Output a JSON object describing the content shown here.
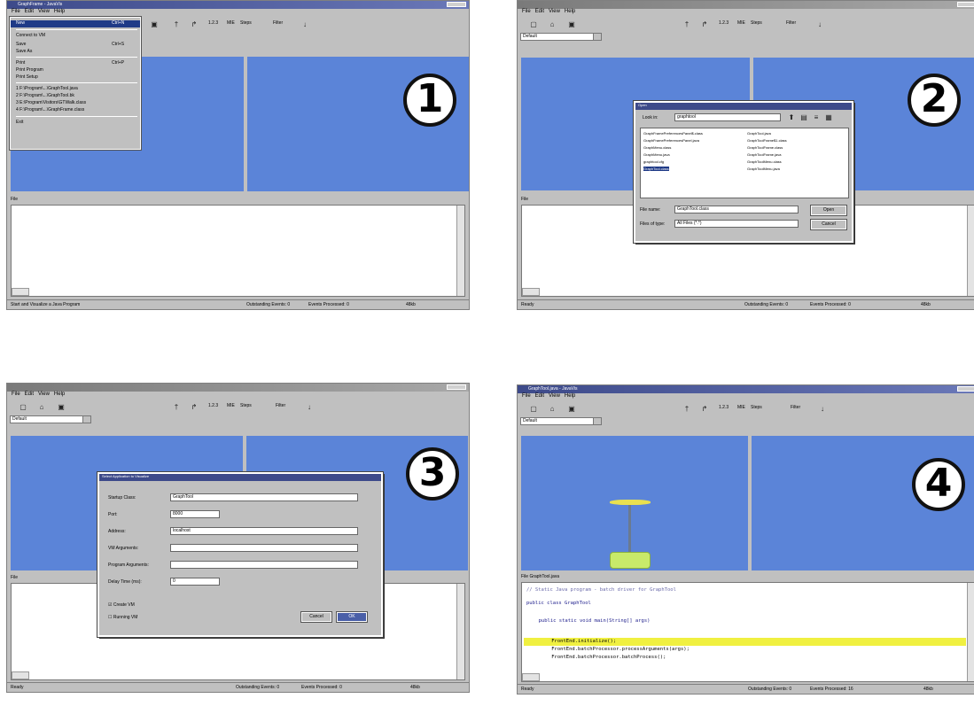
{
  "tool": {
    "debug": "MIE",
    "steps": "Steps",
    "filter": "Filter"
  },
  "combo": "Default",
  "file_label": "File",
  "status": {
    "default_left": "Ready",
    "step1_left": "Start and Visualize a Java Program",
    "outstanding": "Outstanding Events: 0",
    "processed": "Events Processed: 0",
    "step4_processed": "Events Processed: 16",
    "mem": "48kb"
  },
  "badges": [
    "1",
    "2",
    "3",
    "4"
  ],
  "menubar": {
    "file": "File",
    "edit": "Edit",
    "view": "View",
    "help": "Help"
  },
  "w1": {
    "title": "GraphFrame - JavaVis",
    "menu": {
      "new": "New",
      "new_acc": "Ctrl+N",
      "connect": "Connect to VM",
      "save": "Save",
      "save_acc": "Ctrl+S",
      "save_as": "Save As",
      "print": "Print",
      "print_acc": "Ctrl+P",
      "print_program": "Print Program",
      "print_setup": "Print Setup",
      "recent": [
        "1 F:\\Program\\...\\GraphTool.java",
        "2 F:\\Program\\...\\GraphTool.bk",
        "3 E:\\Program\\Visitors\\GTWalk.class",
        "4 F:\\Program\\...\\GraphFrame.class"
      ],
      "exit": "Exit"
    }
  },
  "w2": {
    "dialog": {
      "title": "Open",
      "look_in_label": "Look in:",
      "look_in": "graphtool",
      "files_col1": [
        "GraphFramePreferencesPanel$.class",
        "GraphFramePreferencesPanel.java",
        "GraphMenu.class",
        "GraphMenu.java",
        "graphtool.cfg",
        "GraphTool.class"
      ],
      "files_col2": [
        "GraphTool.java",
        "GraphToolFrame$1.class",
        "GraphToolFrame.class",
        "GraphToolFrame.java",
        "GraphToolMenu.class",
        "GraphToolMenu.java"
      ],
      "filename_label": "File name:",
      "filename": "GraphTool.class",
      "filetype_label": "Files of type:",
      "filetype": "All Files (*.*)",
      "open": "Open",
      "cancel": "Cancel"
    }
  },
  "w3": {
    "dialog": {
      "title": "Select Application to Visualize",
      "fields": [
        {
          "label": "Startup Class:",
          "value": "GraphTool"
        },
        {
          "label": "Port:",
          "value": "8000"
        },
        {
          "label": "Address:",
          "value": "localhost"
        },
        {
          "label": "VM Arguments:",
          "value": ""
        },
        {
          "label": "Program Arguments:",
          "value": ""
        },
        {
          "label": "Delay Time (ms):",
          "value": "0"
        }
      ],
      "check_launch": "Create VM",
      "check_running": "Running VM",
      "cancel": "Cancel",
      "ok": "OK"
    }
  },
  "w4": {
    "title": "GraphTool.java - JavaVis",
    "tabs": "File  GraphTool.java",
    "code": [
      "// Static Java program - batch driver for GraphTool",
      "public class GraphTool",
      "  public static void main(String[] args)",
      "    FrontEnd.initialize();",
      "    FrontEnd.batchProcessor.processArguments(args);",
      "    FrontEnd.batchProcessor.batchProcess();"
    ]
  }
}
